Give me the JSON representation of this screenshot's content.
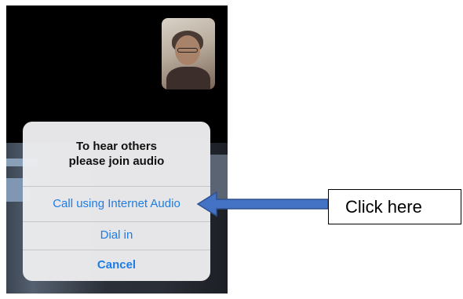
{
  "dialog": {
    "title_line1": "To hear others",
    "title_line2": "please join audio",
    "actions": [
      {
        "label": "Call using Internet Audio"
      },
      {
        "label": "Dial in"
      },
      {
        "label": "Cancel"
      }
    ]
  },
  "annotation": {
    "callout_text": "Click here",
    "arrow_color": "#4472c4"
  },
  "colors": {
    "action_blue": "#1e7ce6",
    "dialog_bg": "#ececee"
  }
}
